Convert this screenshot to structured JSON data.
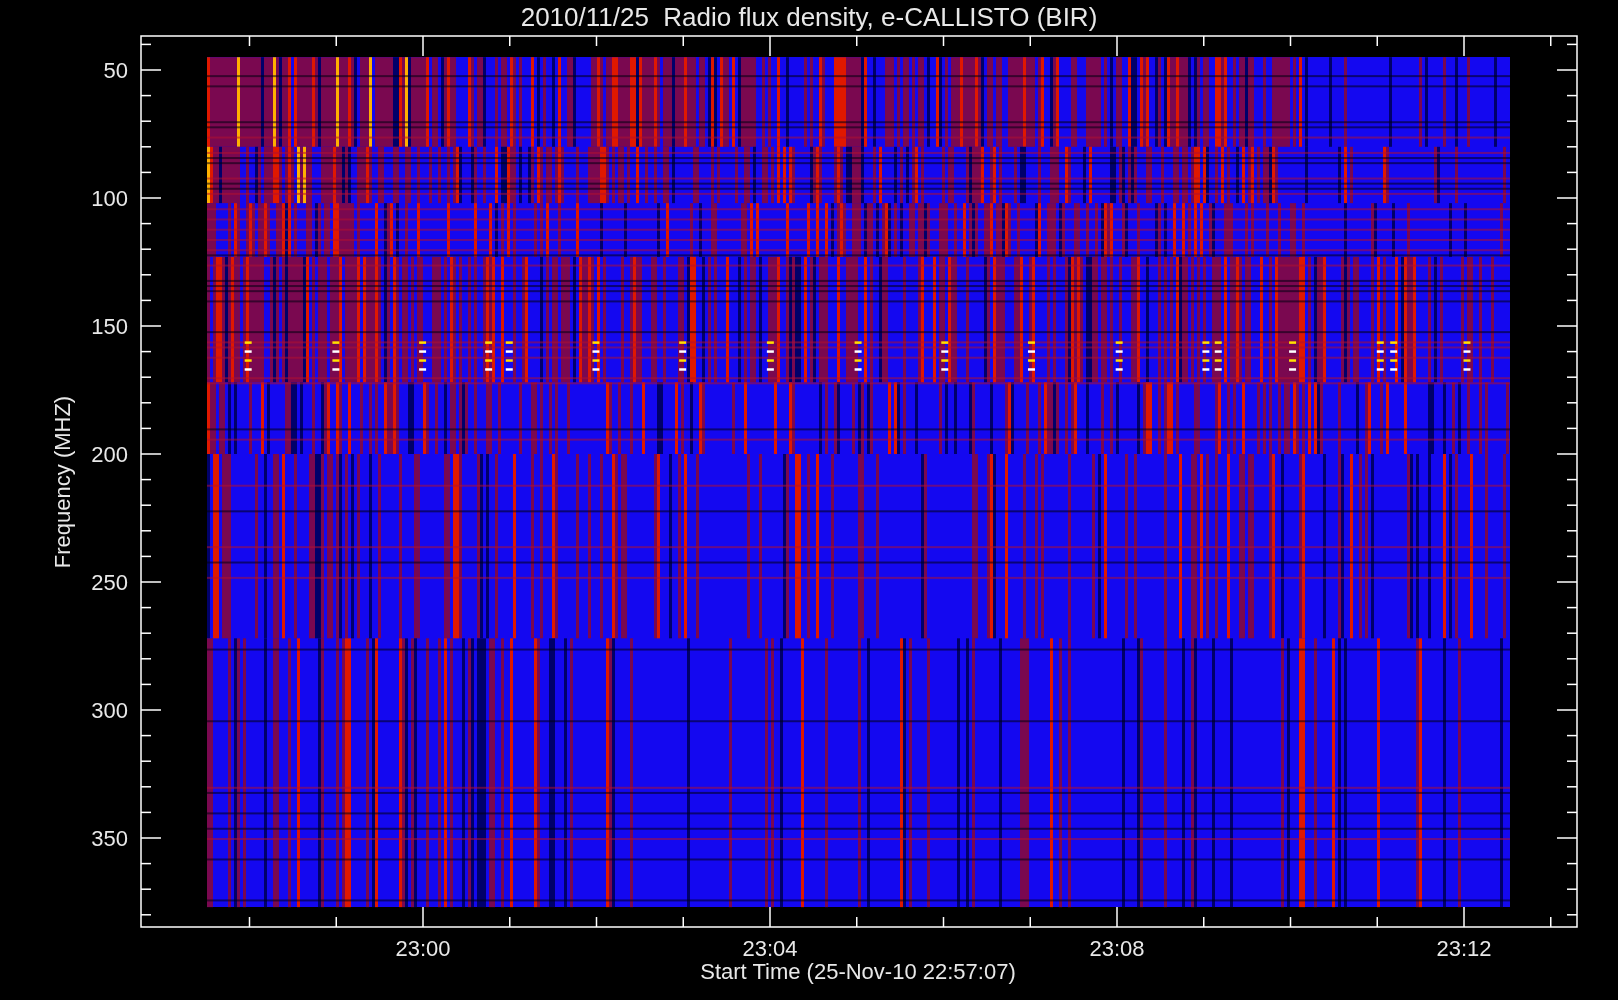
{
  "title": "2010/11/25  Radio flux density, e-CALLISTO (BIR)",
  "y_axis": {
    "label": "Frequency (MHZ)",
    "ticks": [
      "50",
      "100",
      "150",
      "200",
      "250",
      "300",
      "350"
    ]
  },
  "x_axis": {
    "label": "Start Time (25-Nov-10 22:57:07)",
    "ticks": [
      "23:00",
      "23:04",
      "23:08",
      "23:12"
    ]
  }
}
